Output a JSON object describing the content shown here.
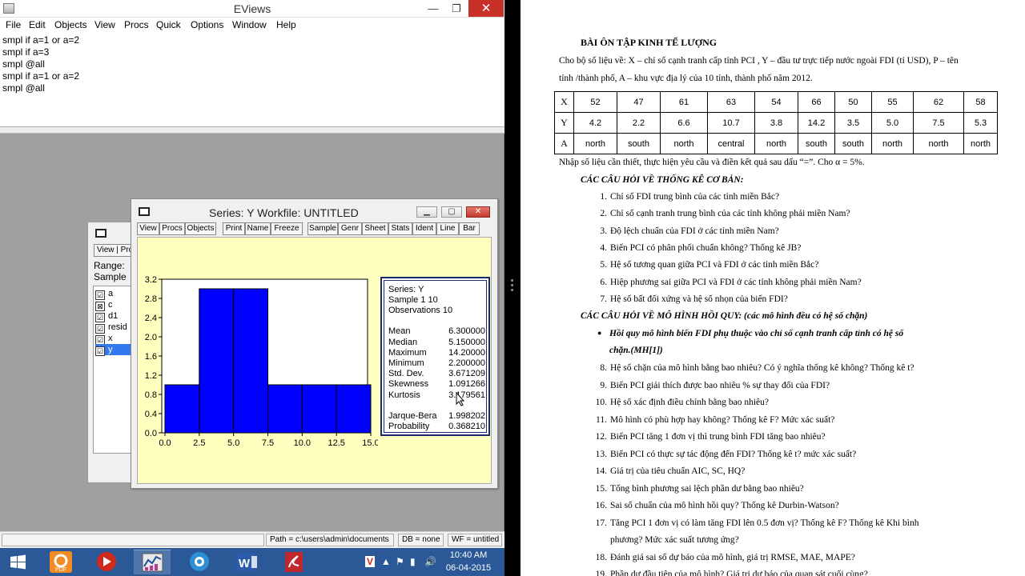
{
  "eviews": {
    "title": "EViews",
    "min": "—",
    "max": "❐",
    "close": "✕",
    "menu": [
      "File",
      "Edit",
      "Objects",
      "View",
      "Procs",
      "Quick",
      "Options",
      "Window",
      "Help"
    ],
    "commands": [
      "smpl if a=1 or a=2",
      "smpl if a=3",
      "smpl @all",
      "smpl if a=1 or a=2",
      "smpl @all"
    ],
    "workfile": {
      "view_btn": "View",
      "procs_btn": "Pro",
      "range": "Range:",
      "sample": "Sample",
      "objects": [
        {
          "icon": "☑",
          "name": "a"
        },
        {
          "icon": "⊠",
          "name": "c"
        },
        {
          "icon": "☑",
          "name": "d1"
        },
        {
          "icon": "☑",
          "name": "resid"
        },
        {
          "icon": "☑",
          "name": "x"
        },
        {
          "icon": "☑",
          "name": "y"
        }
      ]
    },
    "series_window": {
      "title": "Series: Y   Workfile: UNTITLED",
      "toolbar": [
        "View",
        "Procs",
        "Objects",
        "Print",
        "Name",
        "Freeze",
        "Sample",
        "Genr",
        "Sheet",
        "Stats",
        "Ident",
        "Line",
        "Bar"
      ],
      "stats": {
        "series": "Series: Y",
        "sample": "Sample 1 10",
        "observations": "Observations 10",
        "rows": [
          {
            "label": "Mean",
            "value": "6.300000"
          },
          {
            "label": "Median",
            "value": "5.150000"
          },
          {
            "label": "Maximum",
            "value": "14.20000"
          },
          {
            "label": "Minimum",
            "value": "2.200000"
          },
          {
            "label": "Std. Dev.",
            "value": "3.671209"
          },
          {
            "label": "Skewness",
            "value": "1.091266"
          },
          {
            "label": "Kurtosis",
            "value": "3.179561"
          }
        ],
        "jb_rows": [
          {
            "label": "Jarque-Bera",
            "value": "1.998202"
          },
          {
            "label": "Probability",
            "value": "0.368210"
          }
        ]
      }
    },
    "statusbar": {
      "path": "Path = c:\\users\\admin\\documents",
      "db": "DB = none",
      "wf": "WF = untitled"
    },
    "taskbar": {
      "time": "10:40 AM",
      "date": "06-04-2015"
    }
  },
  "chart_data": {
    "type": "bar",
    "bins": [
      [
        0.0,
        2.5
      ],
      [
        2.5,
        5.0
      ],
      [
        5.0,
        7.5
      ],
      [
        7.5,
        10.0
      ],
      [
        10.0,
        12.5
      ],
      [
        12.5,
        15.0
      ]
    ],
    "values": [
      1,
      3,
      3,
      1,
      1,
      1
    ],
    "x_ticks": [
      "0.0",
      "2.5",
      "5.0",
      "7.5",
      "10.0",
      "12.5",
      "15.0"
    ],
    "y_ticks": [
      "0.0",
      "0.4",
      "0.8",
      "1.2",
      "1.6",
      "2.0",
      "2.4",
      "2.8",
      "3.2"
    ],
    "xlim": [
      0,
      15
    ],
    "ylim": [
      0,
      3.2
    ],
    "bar_color": "#0000ff",
    "grid": false
  },
  "doc": {
    "title": "BÀI ÔN TẬP KINH TẾ LƯỢNG",
    "intro1": "Cho bộ số liệu về: X – chỉ số cạnh tranh cấp tỉnh PCI , Y – đầu tư trực tiếp nước ngoài FDI (tỉ USD), P – tên",
    "intro2": "tỉnh /thành phố, A – khu vực địa lý của 10 tỉnh, thành phố năm 2012.",
    "table": {
      "X": [
        "52",
        "47",
        "61",
        "63",
        "54",
        "66",
        "50",
        "55",
        "62",
        "58"
      ],
      "Y": [
        "4.2",
        "2.2",
        "6.6",
        "10.7",
        "3.8",
        "14.2",
        "3.5",
        "5.0",
        "7.5",
        "5.3"
      ],
      "A": [
        "north",
        "south",
        "north",
        "central",
        "north",
        "south",
        "south",
        "north",
        "north",
        "north"
      ]
    },
    "instruction": "Nhập số liệu cần thiết, thực hiện yêu cầu và điền kết quả sau dấu “=”. Cho α = 5%.",
    "section1": "CÁC CÂU HỎI VỀ THỐNG KÊ CƠ BẢN:",
    "questions1": [
      {
        "n": "1.",
        "t": "Chỉ số FDI trung bình của các tỉnh miền Bắc?"
      },
      {
        "n": "2.",
        "t": "Chỉ số cạnh tranh trung bình của các tỉnh không phải miền Nam?"
      },
      {
        "n": "3.",
        "t": "Độ lệch chuẩn của FDI ở các tỉnh miền Nam?"
      },
      {
        "n": "4.",
        "t": "Biến PCI có phân phối chuẩn không? Thống kê JB?"
      },
      {
        "n": "5.",
        "t": "Hệ số tương quan giữa PCI và FDI ở các tỉnh miền Bắc?"
      },
      {
        "n": "6.",
        "t": "Hiệp phương sai giữa PCI và FDI ở các tỉnh không phải miền Nam?"
      },
      {
        "n": "7.",
        "t": "Hệ số bất đối xứng và hệ số nhọn của biến FDI?"
      }
    ],
    "section2": "CÁC CÂU HỎI VỀ MÔ HÌNH HỒI QUY: (các mô hình đều có hệ số chặn)",
    "bullet1": "Hồi quy mô hình biến FDI phụ thuộc vào chỉ số cạnh tranh cấp tỉnh có hệ số",
    "bullet2": "chặn.(MH[1])",
    "questions2": [
      {
        "n": "8.",
        "t": "Hệ số chặn của mô hình bằng bao nhiêu? Có ý nghĩa thống kê không? Thống kê t?"
      },
      {
        "n": "9.",
        "t": "Biến PCI giải thích được bao nhiêu % sự thay đổi của FDI?"
      },
      {
        "n": "10.",
        "t": "Hệ số xác định điều chỉnh bằng bao nhiêu?"
      },
      {
        "n": "11.",
        "t": "Mô hình có phù hợp hay không? Thống kê F? Mức xác suất?"
      },
      {
        "n": "12.",
        "t": "Biến PCI tăng 1 đơn vị thì trung bình FDI tăng bao nhiêu?"
      },
      {
        "n": "13.",
        "t": "Biến PCI có thực sự tác động đến FDI? Thống kê t? mức xác suất?"
      },
      {
        "n": "14.",
        "t": "Giá trị của tiêu chuẩn AIC, SC, HQ?"
      },
      {
        "n": "15.",
        "t": "Tổng bình phương sai lệch phần dư bằng bao nhiêu?"
      },
      {
        "n": "16.",
        "t": "Sai số chuẩn của mô hình hồi quy? Thống kê Durbin-Watson?"
      },
      {
        "n": "17.",
        "t": "Tăng PCI 1 đơn vị có làm tăng FDI lên 0.5 đơn vị?  Thống kê F? Thống kê Khi bình"
      },
      {
        "n": "",
        "t": "phương? Mức xác suất tương ứng?"
      },
      {
        "n": "18.",
        "t": "Đánh giá sai số dự báo của mô hình, giá trị RMSE, MAE, MAPE?"
      },
      {
        "n": "19.",
        "t": "Phần dư đầu tiên của mô hình? Giá trị dự báo của quan sát cuối cùng?"
      }
    ]
  }
}
